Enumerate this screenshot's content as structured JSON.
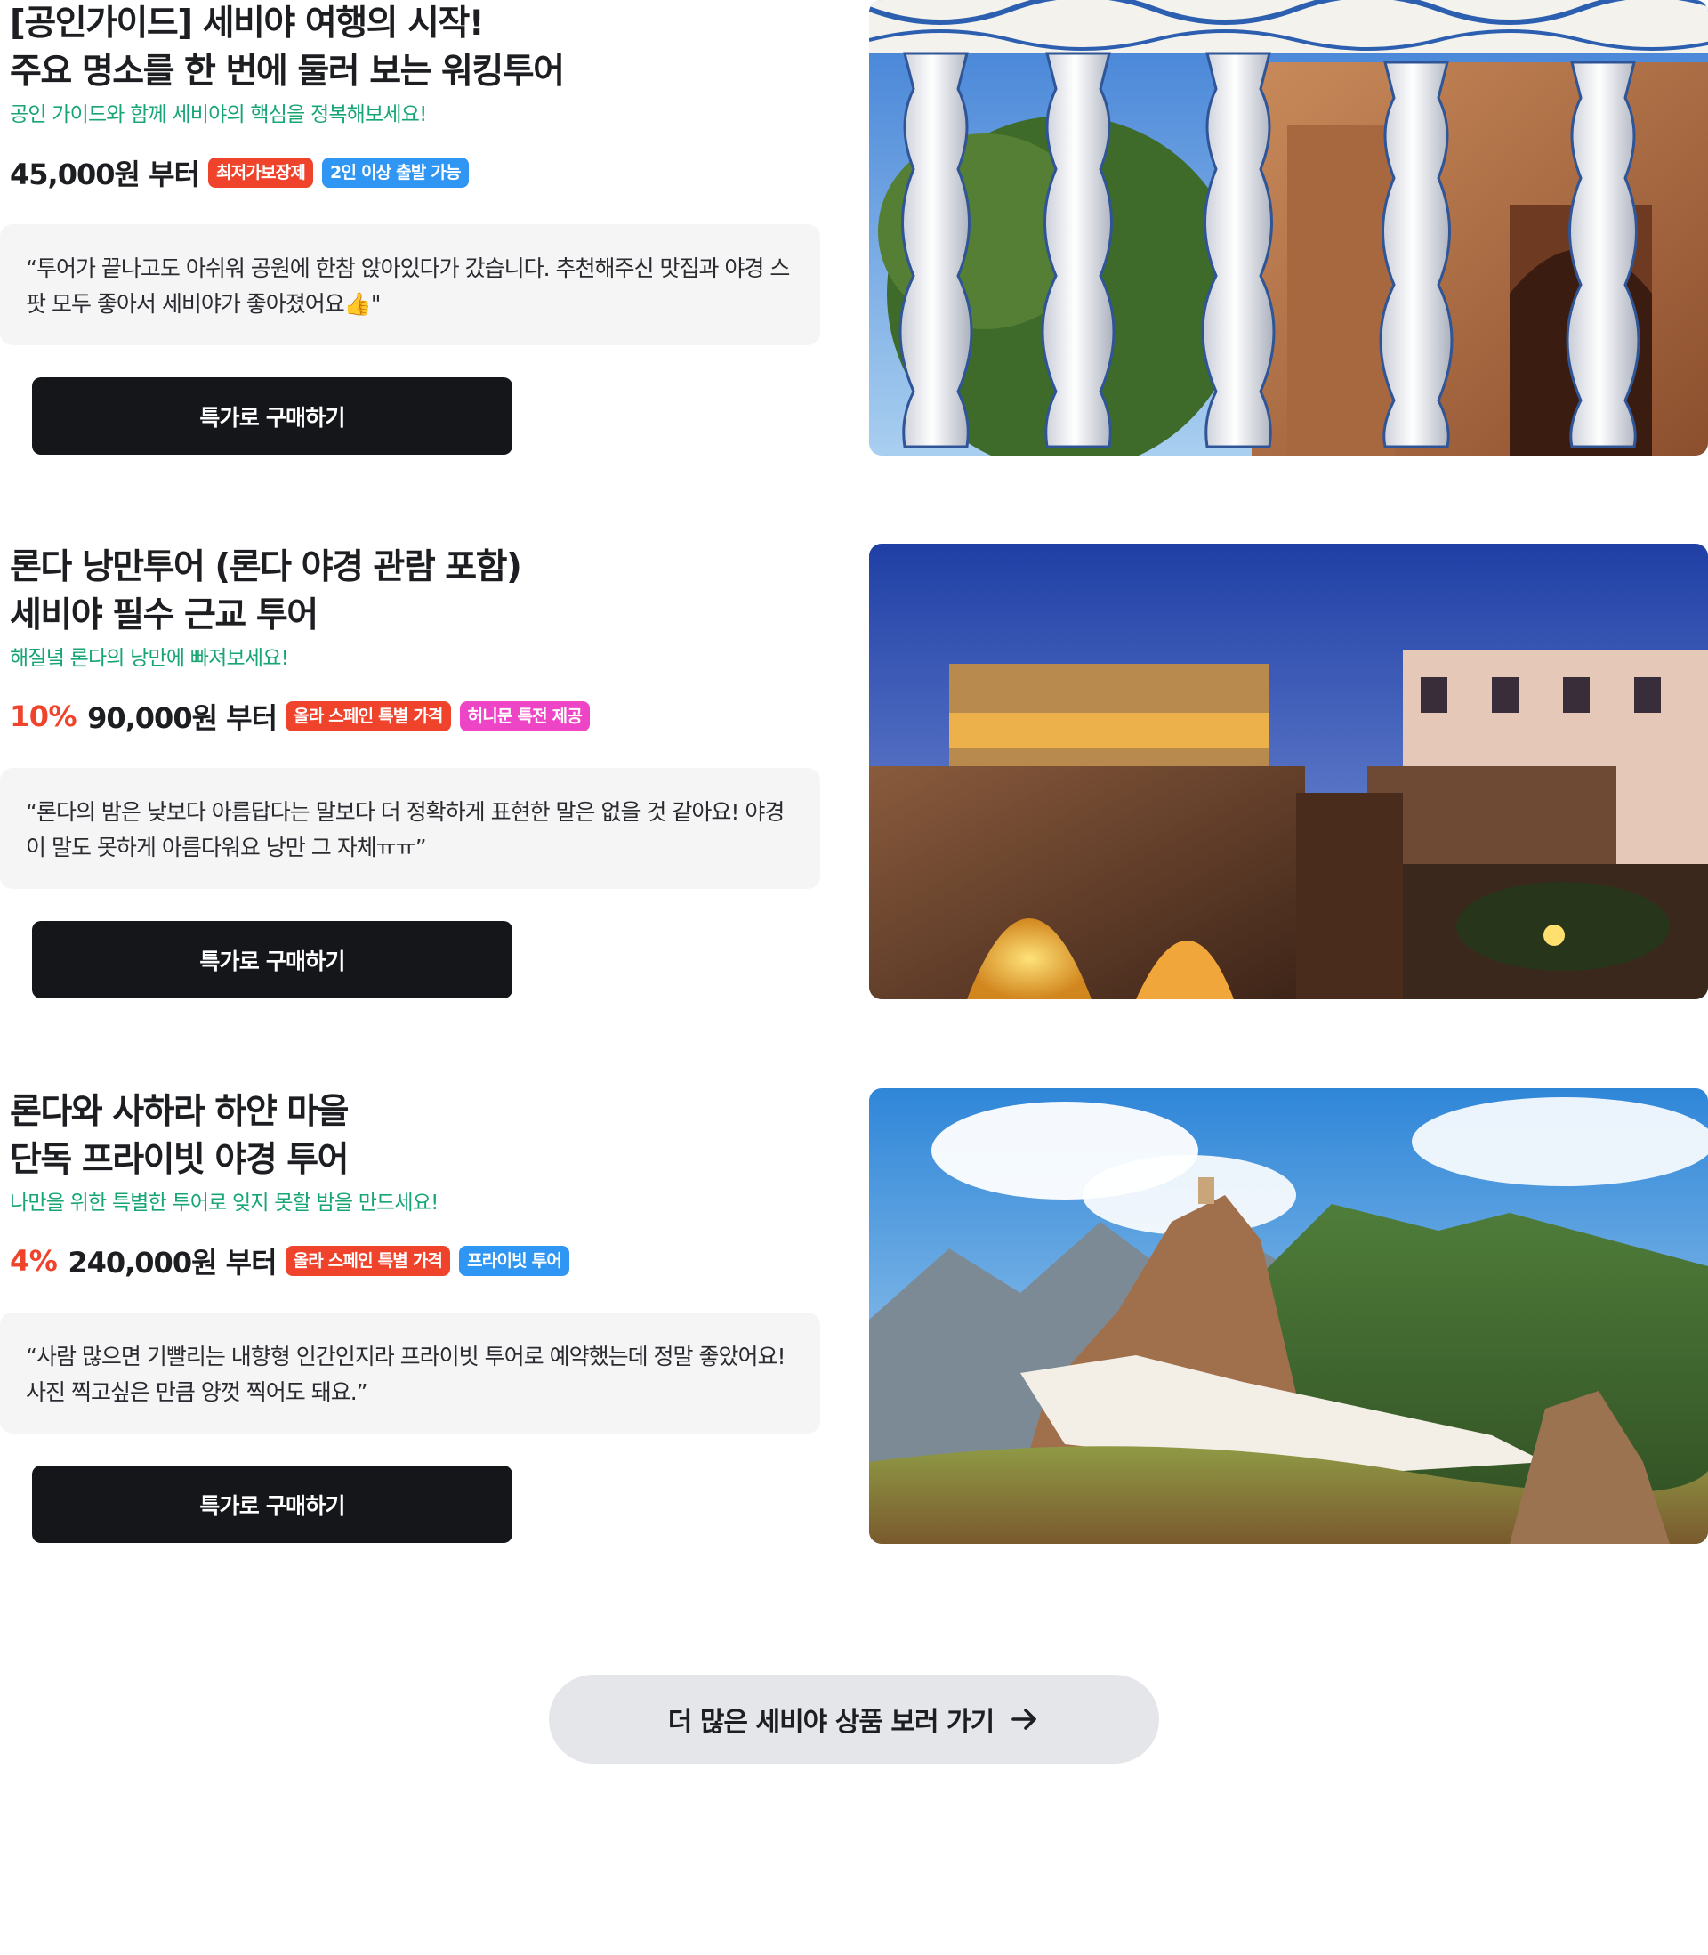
{
  "products": [
    {
      "title_line1": "[공인가이드] 세비야 여행의 시작!",
      "title_line2": "주요 명소를 한 번에 둘러 보는 워킹투어",
      "subtitle": "공인 가이드와 함께 세비야의 핵심을 정복해보세요!",
      "discount": "",
      "price": "45,000원 부터",
      "badges": [
        {
          "label": "최저가보장제",
          "color": "#f0432c"
        },
        {
          "label": "2인 이상 출발 가능",
          "color": "#2f96f3"
        }
      ],
      "review": "“투어가 끝나고도 아쉬워 공원에 한참 앉아있다가 갔습니다. 추천해주신 맛집과 야경 스팟 모두 좋아서 세비야가 좋아졌어요👍\"",
      "button_label": "특가로 구매하기",
      "image_icon": "sevilla-plaza-balustrade-photo"
    },
    {
      "title_line1": "론다 낭만투어 (론다 야경 관람 포함)",
      "title_line2": "세비야 필수 근교 투어",
      "subtitle": "해질녘 론다의 낭만에 빠져보세요!",
      "discount": "10%",
      "price": "90,000원 부터",
      "badges": [
        {
          "label": "올라 스페인 특별 가격",
          "color": "#f0432c"
        },
        {
          "label": "허니문 특전 제공",
          "color": "#ee44c6"
        }
      ],
      "review": "“론다의 밤은 낮보다 아름답다는 말보다 더 정확하게 표현한 말은 없을 것 같아요! 야경이 말도 못하게 아름다워요 낭만 그 자체ㅠㅠ”",
      "button_label": "특가로 구매하기",
      "image_icon": "ronda-bridge-night-photo"
    },
    {
      "title_line1": "론다와 사하라 하얀 마을",
      "title_line2": "단독 프라이빗 야경 투어",
      "subtitle": "나만을 위한 특별한 투어로 잊지 못할 밤을 만드세요!",
      "discount": "4%",
      "price": "240,000원 부터",
      "badges": [
        {
          "label": "올라 스페인 특별 가격",
          "color": "#f0432c"
        },
        {
          "label": "프라이빗 투어",
          "color": "#2f96f3"
        }
      ],
      "review": "“사람 많으면 기빨리는 내향형 인간인지라 프라이빗 투어로 예약했는데 정말 좋았어요! 사진 찍고싶은 만큼 양껏 찍어도 돼요.”",
      "button_label": "특가로 구매하기",
      "image_icon": "zahara-white-village-photo"
    }
  ],
  "more_button": {
    "label": "더 많은 세비야 상품 보러 가기",
    "icon": "arrow-right-icon"
  }
}
